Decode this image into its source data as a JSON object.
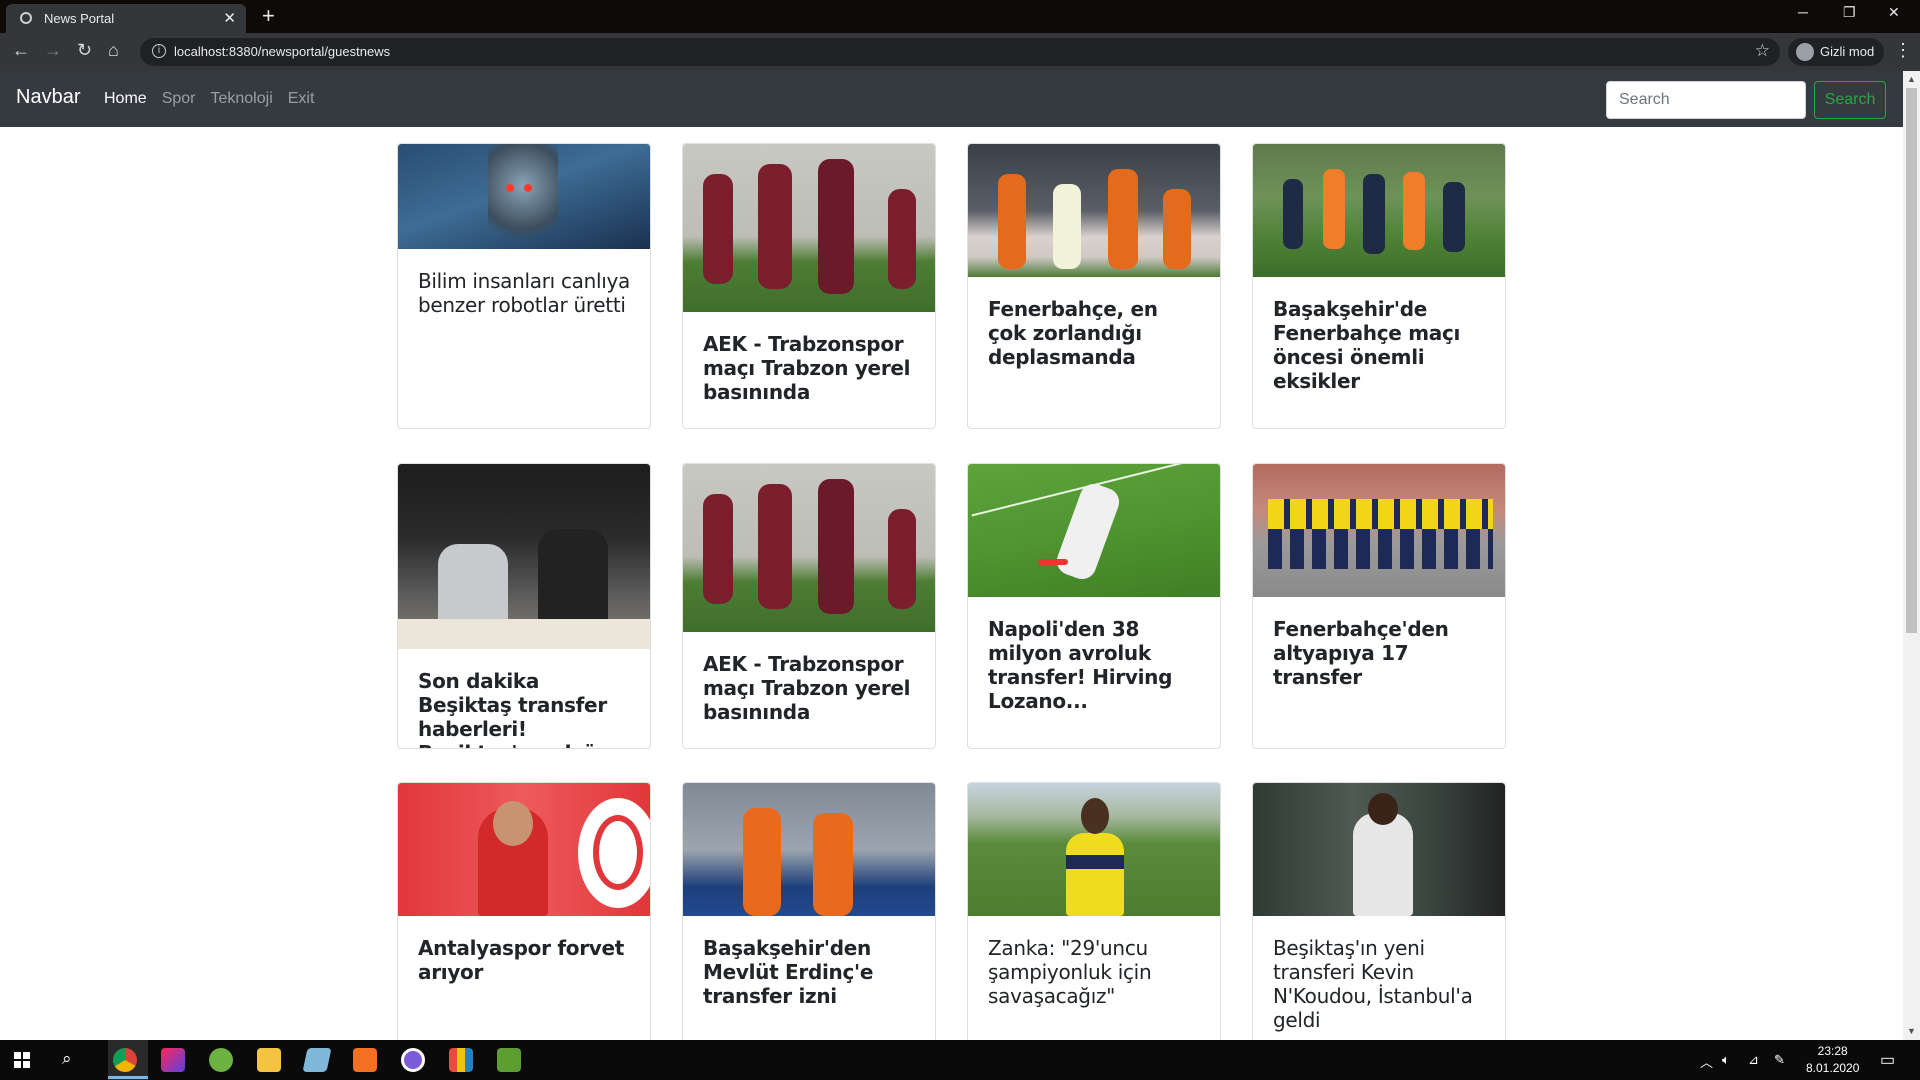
{
  "browser": {
    "tab_title": "News Portal",
    "url": "localhost:8380/newsportal/guestnews",
    "incognito_label": "Gizli mod"
  },
  "navbar": {
    "brand": "Navbar",
    "links": [
      "Home",
      "Spor",
      "Teknoloji",
      "Exit"
    ],
    "active_link": "Home",
    "search_placeholder": "Search",
    "search_button": "Search",
    "accent_color": "#28a745"
  },
  "news": [
    {
      "title": "Bilim insanları canlıya benzer robotlar üretti",
      "image": "robot"
    },
    {
      "title": "AEK - Trabzonspor maçı Trabzon yerel basınında",
      "image": "trabzon-players"
    },
    {
      "title": "Fenerbahçe, en çok zorlandığı deplasmanda",
      "image": "fenerbahce-match"
    },
    {
      "title": "Başakşehir'de Fenerbahçe maçı öncesi önemli eksikler",
      "image": "basaksehir-training"
    },
    {
      "title": "Son dakika Beşiktaş transfer haberleri! Beşiktaş'a golcü müjdesi",
      "image": "besiktas-signing"
    },
    {
      "title": "AEK - Trabzonspor maçı Trabzon yerel basınında",
      "image": "trabzon-players"
    },
    {
      "title": "Napoli'den 38 milyon avroluk transfer! Hirving Lozano...",
      "image": "lozano"
    },
    {
      "title": "Fenerbahçe'den altyapıya 17 transfer",
      "image": "youth-team"
    },
    {
      "title": "Antalyaspor forvet arıyor",
      "image": "antalyaspor"
    },
    {
      "title": "Başakşehir'den Mevlüt Erdinç'e transfer izni",
      "image": "basaksehir-celebrate"
    },
    {
      "title": "Zanka: \"29'uncu şampiyonluk için savaşacağız\"",
      "image": "zanka"
    },
    {
      "title": "Beşiktaş'ın yeni transferi Kevin N'Koudou, İstanbul'a geldi",
      "image": "nkoudou"
    }
  ],
  "taskbar": {
    "time": "23:28",
    "date": "8.01.2020"
  }
}
